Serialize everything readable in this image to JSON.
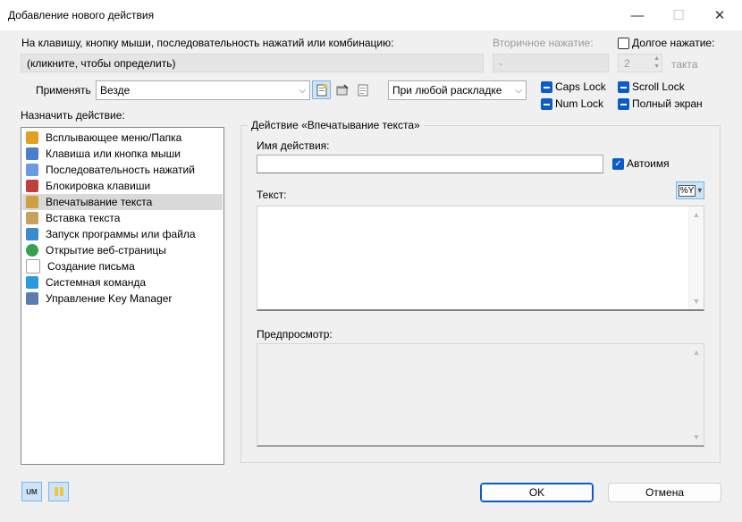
{
  "window": {
    "title": "Добавление нового действия"
  },
  "trigger": {
    "label": "На клавишу, кнопку мыши, последовательность нажатий или комбинацию:",
    "value": "(кликните, чтобы определить)",
    "secondary_label": "Вторичное нажатие:",
    "secondary_value": "-",
    "long_press_label": "Долгое нажатие:",
    "long_press_value": "2",
    "long_press_unit": "такта"
  },
  "apply": {
    "label": "Применять",
    "scope_value": "Везде",
    "layout_value": "При любой раскладке"
  },
  "modifiers": {
    "caps_lock": "Caps Lock",
    "scroll_lock": "Scroll Lock",
    "num_lock": "Num Lock",
    "fullscreen": "Полный экран"
  },
  "actions": {
    "label": "Назначить действие:",
    "items": [
      {
        "label": "Всплывающее меню/Папка",
        "color": "#e0a020"
      },
      {
        "label": "Клавиша или кнопка мыши",
        "color": "#4a7fd0"
      },
      {
        "label": "Последовательность нажатий",
        "color": "#6a9ae0"
      },
      {
        "label": "Блокировка клавиши",
        "color": "#c04040"
      },
      {
        "label": "Впечатывание текста",
        "color": "#d0a040"
      },
      {
        "label": "Вставка текста",
        "color": "#c8a060"
      },
      {
        "label": "Запуск программы или файла",
        "color": "#3a8ad0"
      },
      {
        "label": "Открытие веб-страницы",
        "color": "#3aa050"
      },
      {
        "label": "Создание письма",
        "color": "#a0a0a0"
      },
      {
        "label": "Системная команда",
        "color": "#2a9ae0"
      },
      {
        "label": "Управление Key Manager",
        "color": "#5a7ab0"
      }
    ]
  },
  "detail": {
    "group_label": "Действие «Впечатывание текста»",
    "name_label": "Имя действия:",
    "name_value": "",
    "autoname_label": "Автоимя",
    "text_label": "Текст:",
    "macro_label": "%Y",
    "preview_label": "Предпросмотр:"
  },
  "footer": {
    "ok_label": "OK",
    "cancel_label": "Отмена",
    "badge_text": "UM"
  }
}
